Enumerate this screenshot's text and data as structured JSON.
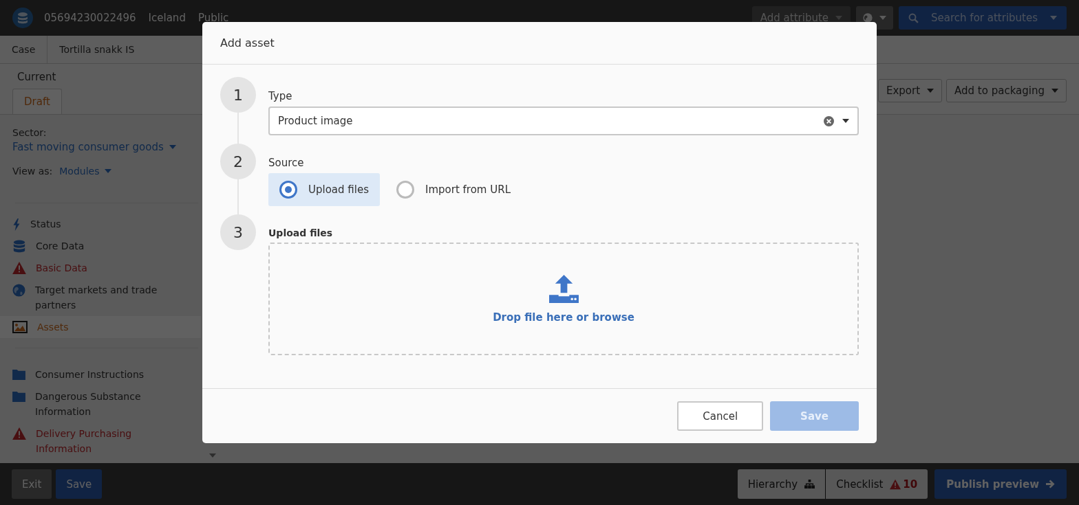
{
  "topbar": {
    "gtin": "05694230022496",
    "market": "Iceland",
    "visibility": "Public",
    "add_attribute": "Add attribute",
    "search": "Search for attributes"
  },
  "breadcrumb": [
    "Case",
    "Tortilla snakk IS"
  ],
  "version": {
    "label": "Current",
    "tabs": [
      {
        "label": "Draft",
        "selected": true
      }
    ]
  },
  "sector": {
    "label": "Sector:",
    "value": "Fast moving consumer goods"
  },
  "view_as": {
    "label": "View as:",
    "value": "Modules"
  },
  "modules": [
    {
      "label": "Status",
      "kind": "bolt",
      "warning": false,
      "selected": false
    },
    {
      "label": "Core Data",
      "kind": "database",
      "warning": false,
      "selected": false
    },
    {
      "label": "Basic Data",
      "kind": "alert",
      "warning": true,
      "selected": false
    },
    {
      "label": "Target markets and trade partners",
      "kind": "globe",
      "warning": false,
      "selected": false
    },
    {
      "label": "Assets",
      "kind": "image",
      "warning": false,
      "selected": true
    }
  ],
  "groups": [
    {
      "label": "Consumer Instructions",
      "kind": "folder",
      "warning": false
    },
    {
      "label": "Dangerous Substance Information",
      "kind": "folder",
      "warning": false
    },
    {
      "label": "Delivery Purchasing Information",
      "kind": "alert",
      "warning": true
    }
  ],
  "toolbar": [
    "Export",
    "Add to packaging"
  ],
  "footer": {
    "exit": "Exit",
    "save": "Save",
    "hierarchy": "Hierarchy",
    "checklist": "Checklist",
    "checklist_count": "10",
    "publish": "Publish preview"
  },
  "modal": {
    "title": "Add asset",
    "steps": [
      {
        "number": "1",
        "label": "Type",
        "kind": "select",
        "value": "Product image"
      },
      {
        "number": "2",
        "label": "Source",
        "kind": "radio",
        "options": [
          {
            "label": "Upload files",
            "selected": true
          },
          {
            "label": "Import from URL",
            "selected": false
          }
        ]
      },
      {
        "number": "3",
        "label": "Upload files",
        "kind": "dropzone",
        "text": "Drop file here or browse"
      }
    ],
    "cancel": "Cancel",
    "save": {
      "label": "Save",
      "disabled": true
    }
  }
}
